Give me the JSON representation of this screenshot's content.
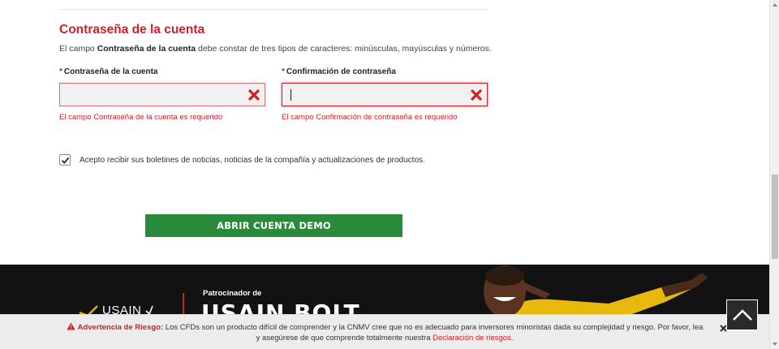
{
  "account_password": {
    "title": "Contraseña de la cuenta",
    "desc_prefix": "El campo ",
    "desc_bold": "Contraseña de la cuenta",
    "desc_suffix": " debe constar de tres tipos de caracteres: minúsculas, mayúsculas y números.",
    "fields": [
      {
        "required_mark": "*",
        "label": "Contraseña de la cuenta",
        "value": "",
        "error": "El campo Contraseña de la cuenta es requerido"
      },
      {
        "required_mark": "*",
        "label": "Confirmación de contraseña",
        "value": "",
        "error": "El campo Confirmación de contraseña es requerido"
      }
    ]
  },
  "consent": {
    "checked": true,
    "label": "Acepto recibir sus boletines de noticias, noticias de la compañía y actualizaciones de productos."
  },
  "cta": {
    "label": "ABRIR CUENTA DEMO"
  },
  "banner": {
    "logo_text": "USAIN",
    "sponsor_label": "Patrocinador de",
    "sponsor_name": "USAIN BOLT"
  },
  "risk_warning": {
    "title": "Advertencia de Riesgo:",
    "text_line1": " Los CFDs son un producto difícil de comprender y la CNMV cree que no es adecuado para inversores minoristas dada su complejidad y riesgo. Por favor, lea",
    "text_line2": "y asegúrese de que comprende totalmente nuestra ",
    "link": "Declaración de riesgos",
    "text_end": "."
  },
  "colors": {
    "accent_red": "#d21f26",
    "cta_green": "#2a8a3c",
    "banner_bg": "#121212",
    "warning_bg": "#ececec"
  },
  "icons": [
    "error-x-icon",
    "checkmark-icon",
    "warning-triangle-icon",
    "close-icon",
    "chevron-up-icon"
  ]
}
